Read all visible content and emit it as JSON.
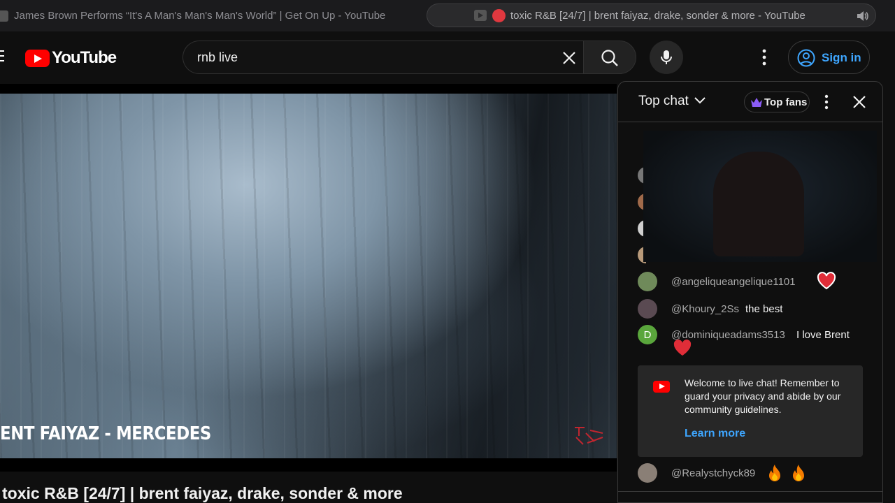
{
  "browser": {
    "tabs": [
      {
        "title": "James Brown Performs “It's A Man's Man's Man's World” | Get On Up - YouTube",
        "active": false
      },
      {
        "title": "toxic R&B [24/7] | brent faiyaz, drake, sonder & more - YouTube",
        "active": true,
        "audio": "speaker-icon",
        "live_indicator_color": "#e0383f"
      }
    ]
  },
  "header": {
    "logo_text": "YouTube",
    "search_value": "rnb live",
    "signin_label": "Sign in",
    "accent_color": "#3ea6ff",
    "brand_color": "#ff0000"
  },
  "player": {
    "caption": "ENT FAIYAZ - MERCEDES",
    "title": "toxic R&B [24/7] | brent faiyaz, drake, sonder & more"
  },
  "chat": {
    "mode_label": "Top chat",
    "filter_label": "Top fans",
    "messages": [
      {
        "author": "@angeliqueangelique1101",
        "text": "",
        "emoji": "heart-icon",
        "avatar_color": "#6f8a5a"
      },
      {
        "author": "@Khoury_2Ss",
        "text": "the best",
        "avatar_color": "#5a4a52"
      },
      {
        "author": "@dominiqueadams3513",
        "text": "I love Brent",
        "emoji": "heart-icon",
        "avatar_letter": "D",
        "avatar_color": "#5aa63c"
      },
      {
        "author": "@Realystchyck89",
        "text": "",
        "emoji": "fire-icon",
        "emoji_count": 2,
        "avatar_color": "#8a7f76"
      }
    ],
    "welcome": {
      "text": "Welcome to live chat! Remember to guard your privacy and abide by our community guidelines.",
      "link": "Learn more"
    }
  }
}
